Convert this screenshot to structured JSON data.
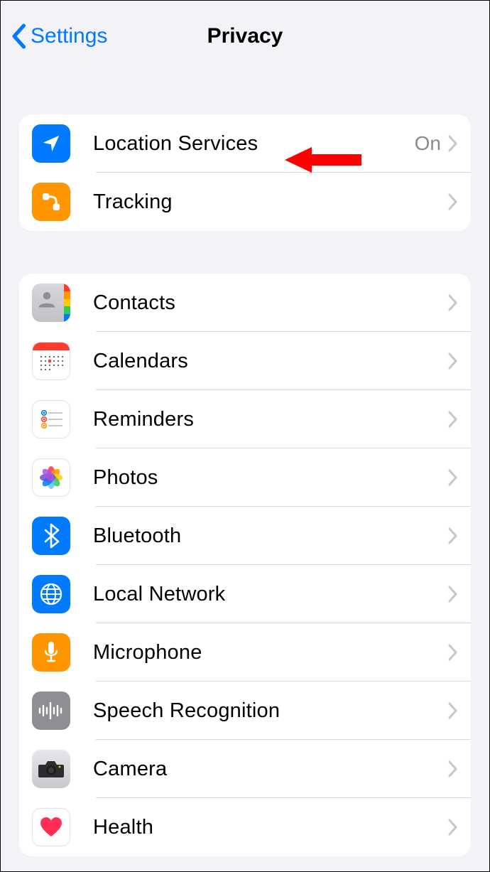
{
  "nav": {
    "back_label": "Settings",
    "title": "Privacy"
  },
  "group1": [
    {
      "label": "Location Services",
      "value": "On",
      "icon": "location"
    },
    {
      "label": "Tracking",
      "value": "",
      "icon": "tracking"
    }
  ],
  "group2": [
    {
      "label": "Contacts",
      "icon": "contacts"
    },
    {
      "label": "Calendars",
      "icon": "calendars"
    },
    {
      "label": "Reminders",
      "icon": "reminders"
    },
    {
      "label": "Photos",
      "icon": "photos"
    },
    {
      "label": "Bluetooth",
      "icon": "bluetooth"
    },
    {
      "label": "Local Network",
      "icon": "network"
    },
    {
      "label": "Microphone",
      "icon": "microphone"
    },
    {
      "label": "Speech Recognition",
      "icon": "speech"
    },
    {
      "label": "Camera",
      "icon": "camera"
    },
    {
      "label": "Health",
      "icon": "health"
    }
  ],
  "annotation": {
    "type": "arrow-pointer",
    "target": "Location Services"
  }
}
